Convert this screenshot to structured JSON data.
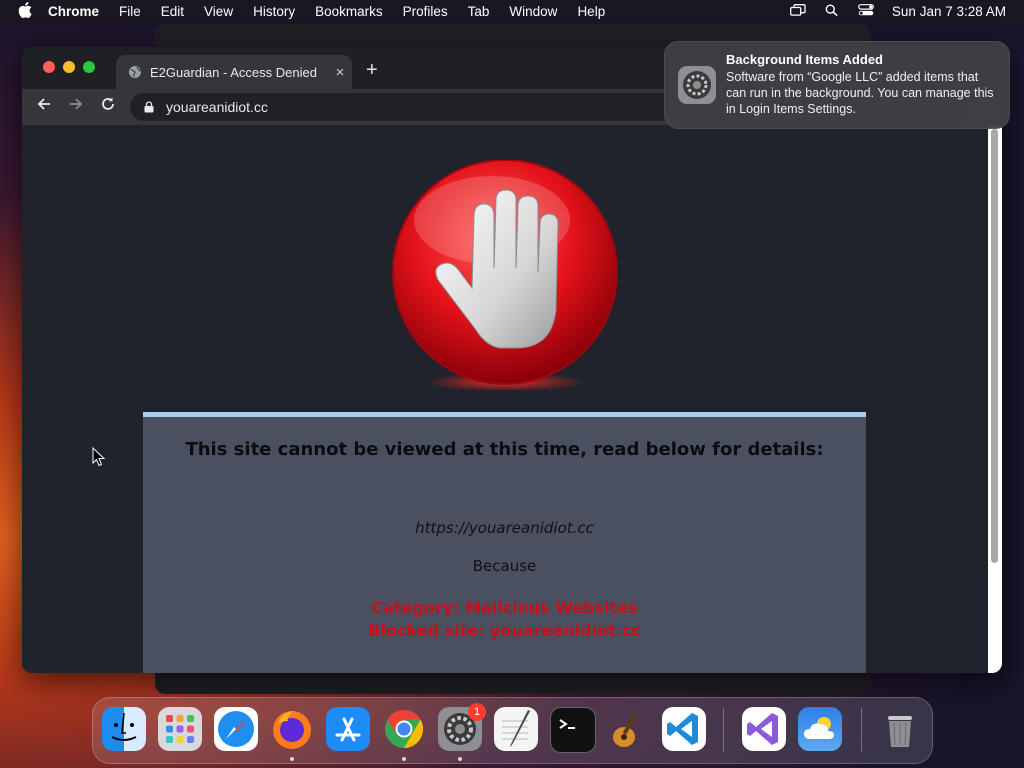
{
  "menubar": {
    "app_name": "Chrome",
    "menus": [
      "File",
      "Edit",
      "View",
      "History",
      "Bookmarks",
      "Profiles",
      "Tab",
      "Window",
      "Help"
    ],
    "clock": "Sun Jan 7  3:28 AM",
    "status_icons": [
      "screen-mirroring-icon",
      "spotlight-search-icon",
      "control-center-icon"
    ]
  },
  "browser": {
    "tab_title": "E2Guardian - Access Denied",
    "tab_close": "×",
    "new_tab": "+",
    "address": "youareanidiot.cc"
  },
  "blockpage": {
    "heading": "This site cannot be viewed at this time, read below for details:",
    "blocked_url": "https://youareanidiot.cc",
    "because": "Because",
    "category": "Category: Malicious Websites",
    "blocked_site": "Blocked site: youareanidiot.cc",
    "panel_color": "#4a5060",
    "alert_color": "#c8101a"
  },
  "notification": {
    "title": "Background Items Added",
    "body": "Software from “Google LLC” added items that can run in the background. You can manage this in Login Items Settings."
  },
  "dock": {
    "apps": [
      "Finder",
      "Launchpad",
      "Safari",
      "Firefox",
      "App Store",
      "Google Chrome",
      "System Settings",
      "TextEdit",
      "Terminal",
      "GarageBand",
      "Visual Studio Code",
      "Visual Studio",
      "Weather",
      "Trash"
    ],
    "system_settings_badge": "1"
  }
}
